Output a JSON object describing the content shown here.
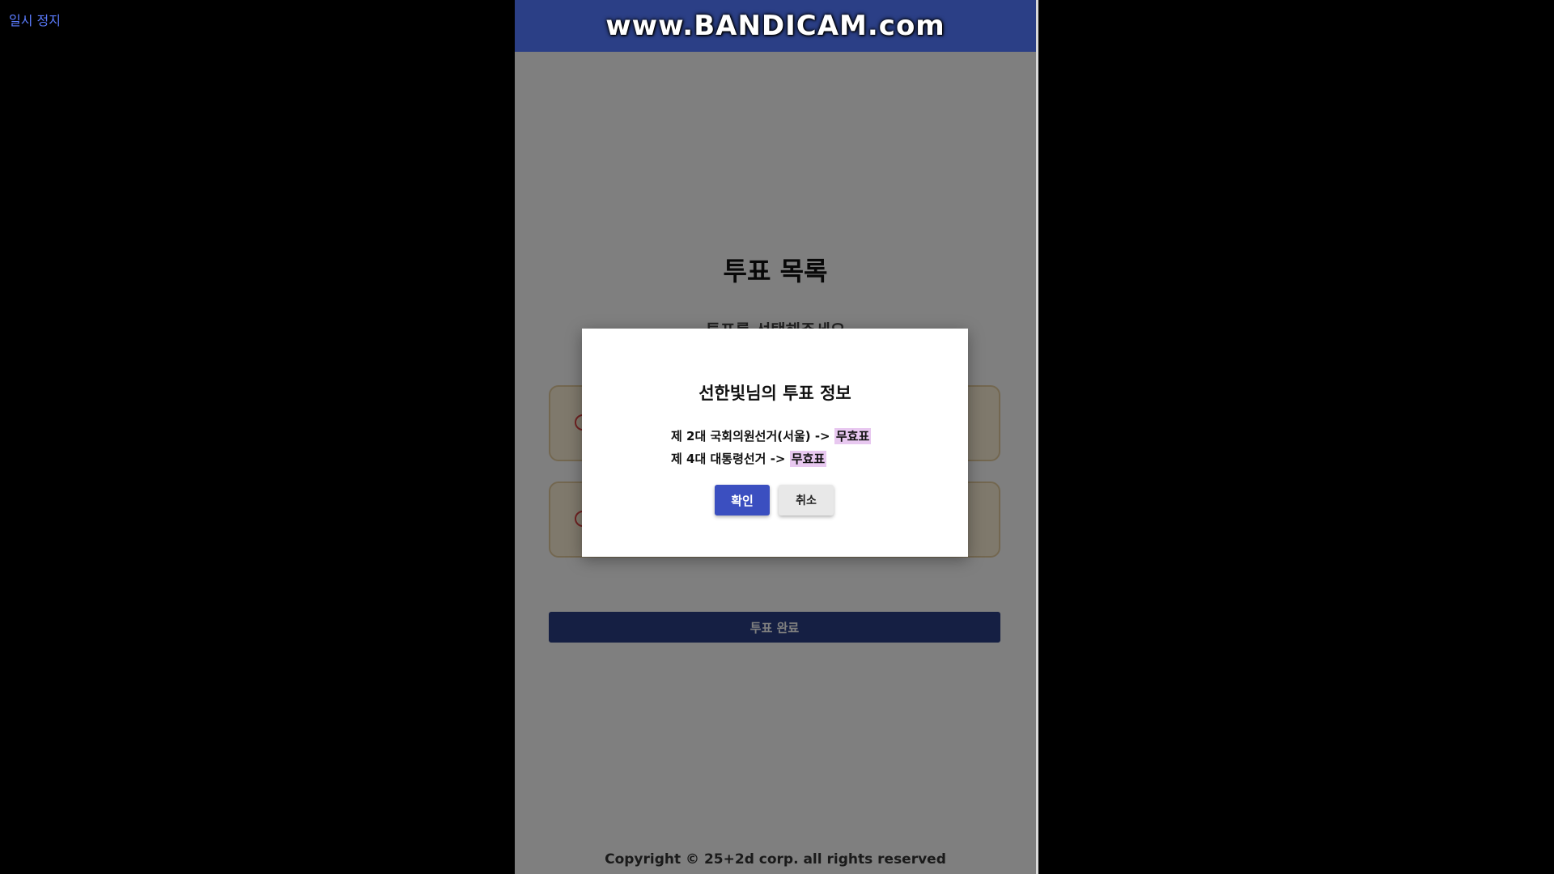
{
  "player": {
    "pause_label": "일시 정지",
    "watermark": "www.BANDICAM.com"
  },
  "page": {
    "title": "투표 목록",
    "subtitle": "투표를 선택해주세요",
    "complete_button": "투표 완료",
    "copyright": "Copyright © 25+2d corp. all rights reserved"
  },
  "modal": {
    "title": "선한빛님의 투표 정보",
    "votes": [
      {
        "name": "제 2대 국회의원선거(서울) ->",
        "result": "무효표"
      },
      {
        "name": "제 4대 대통령선거 ->",
        "result": "무효표"
      }
    ],
    "confirm_label": "확인",
    "cancel_label": "취소"
  },
  "colors": {
    "brand_navy": "#2b3f86",
    "confirm_blue": "#3b4fc0",
    "highlight_pink": "#e8c8f0",
    "card_bg": "#fff3d8"
  }
}
